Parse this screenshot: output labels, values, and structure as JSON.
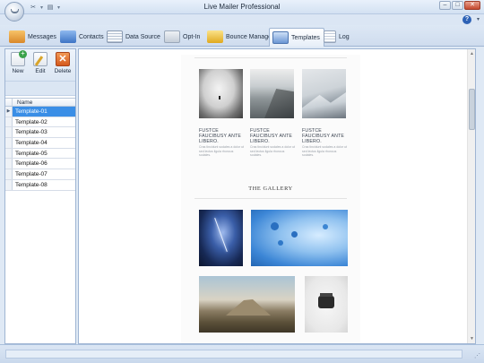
{
  "window": {
    "title": "Live Mailer Professional"
  },
  "quick_access": {
    "items": [
      "tools-icon",
      "save-icon"
    ]
  },
  "tabs": [
    {
      "label": "Messages",
      "icon": "messages-icon",
      "color": "#e8a23a",
      "active": false
    },
    {
      "label": "Contacts",
      "icon": "contacts-icon",
      "color": "#4b8bd6",
      "active": false
    },
    {
      "label": "Data Source",
      "icon": "data-source-icon",
      "color": "#7c8ea6",
      "active": false
    },
    {
      "label": "Opt-In",
      "icon": "opt-in-icon",
      "color": "#6a7a90",
      "active": false
    },
    {
      "label": "Bounce Manager",
      "icon": "bounce-manager-icon",
      "color": "#e5b52a",
      "active": false
    },
    {
      "label": "Templates",
      "icon": "templates-icon",
      "color": "#5b87c9",
      "active": true
    },
    {
      "label": "Log",
      "icon": "log-icon",
      "color": "#8c9bb0",
      "active": false
    }
  ],
  "toolbar": {
    "new_label": "New",
    "edit_label": "Edit",
    "delete_label": "Delete"
  },
  "template_list": {
    "column_header": "Name",
    "rows": [
      "Template-01",
      "Template-02",
      "Template-03",
      "Template-04",
      "Template-05",
      "Template-06",
      "Template-07",
      "Template-08"
    ],
    "selected_index": 0
  },
  "preview": {
    "columns": [
      {
        "title": "FUSTCE FAUCIBUSY ANTE LIBERO.",
        "text": "Cras tincidunt sodales a dolor ut sed lectus ligula rhoncus sodales."
      },
      {
        "title": "FUSTCE FAUCIBUSY ANTE LIBERO.",
        "text": "Cras tincidunt sodales a dolor ut sed lectus ligula rhoncus sodales."
      },
      {
        "title": "FUSTCE FAUCIBUSY ANTE LIBERO.",
        "text": "Cras tincidunt sodales a dolor ut sed lectus ligula rhoncus sodales."
      }
    ],
    "gallery_heading": "THE GALLERY"
  },
  "colors": {
    "selection": "#3a8ee6",
    "chrome": "#dfe9f5",
    "help": "#2d62b6",
    "delete": "#e06a2a",
    "new": "#3aa24a"
  }
}
